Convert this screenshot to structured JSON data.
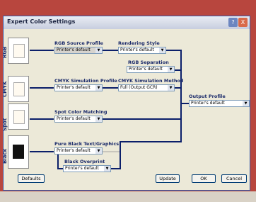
{
  "window": {
    "title": "Expert Color Settings",
    "help": "?",
    "close": "X"
  },
  "rows": {
    "rgb": "RGB",
    "cmyk": "CMYK",
    "spot": "Spot",
    "black": "Black"
  },
  "rgb_source": {
    "label": "RGB Source Profile",
    "value": "Printer's default"
  },
  "rendering": {
    "label": "Rendering Style",
    "value": "Printer's default"
  },
  "rgb_sep": {
    "label": "RGB Separation",
    "value": "Printer's default"
  },
  "cmyk_sim": {
    "label": "CMYK Simulation Profile",
    "value": "Printer's default"
  },
  "cmyk_method": {
    "label": "CMYK Simulation Method",
    "value": "Full (Output GCR)"
  },
  "output": {
    "label": "Output Profile",
    "value": "Printer's default"
  },
  "spot": {
    "label": "Spot Color Matching",
    "value": "Printer's default"
  },
  "pure_black": {
    "label": "Pure Black Text/Graphics",
    "value": "Printer's default"
  },
  "black_overprint": {
    "label": "Black Overprint",
    "value": "Printer's default"
  },
  "buttons": {
    "defaults": "Defaults",
    "update": "Update",
    "ok": "OK",
    "cancel": "Cancel"
  }
}
